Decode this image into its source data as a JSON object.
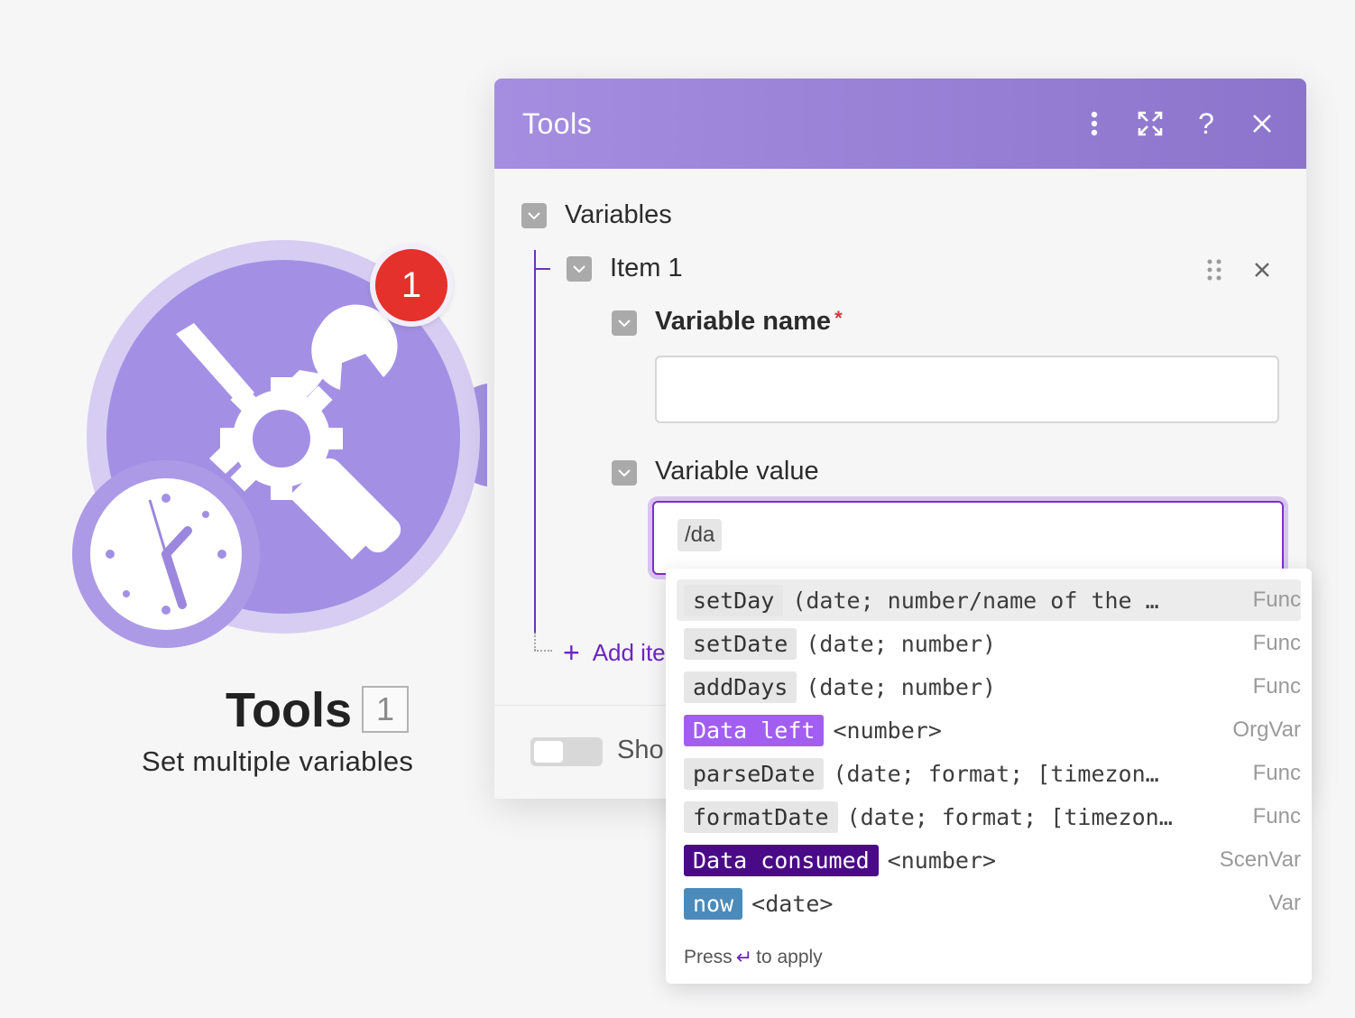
{
  "node": {
    "badge": "1",
    "title": "Tools",
    "count": "1",
    "subtitle": "Set multiple variables",
    "icon": "tools-wrench-screwdriver-gear-icon",
    "clock_icon": "clock-icon"
  },
  "panel": {
    "title": "Tools",
    "header_buttons": [
      "more-vertical-icon",
      "expand-icon",
      "help-icon",
      "close-icon"
    ],
    "help_label": "?",
    "variables_label": "Variables",
    "item_label": "Item 1",
    "variable_name_label": "Variable name",
    "required_mark": "*",
    "variable_name_value": "",
    "variable_value_label": "Variable value",
    "variable_value_token": "/da",
    "add_item_label": "Add ite",
    "add_item_plus": "+",
    "show_label": "Sho"
  },
  "dropdown": {
    "items": [
      {
        "name": "setDay",
        "args": "(date; number/name of the …",
        "kind": "Func",
        "chip": "func",
        "selected": true
      },
      {
        "name": "setDate",
        "args": "(date; number)",
        "kind": "Func",
        "chip": "func",
        "selected": false
      },
      {
        "name": "addDays",
        "args": "(date; number)",
        "kind": "Func",
        "chip": "func",
        "selected": false
      },
      {
        "name": "Data left",
        "args": "<number>",
        "kind": "OrgVar",
        "chip": "orgvar",
        "selected": false
      },
      {
        "name": "parseDate",
        "args": "(date; format; [timezon…",
        "kind": "Func",
        "chip": "func",
        "selected": false
      },
      {
        "name": "formatDate",
        "args": "(date; format; [timezon…",
        "kind": "Func",
        "chip": "func",
        "selected": false
      },
      {
        "name": "Data consumed",
        "args": "<number>",
        "kind": "ScenVar",
        "chip": "scenvar",
        "selected": false
      },
      {
        "name": "now",
        "args": "<date>",
        "kind": "Var",
        "chip": "var",
        "selected": false
      }
    ],
    "footer_press": "Press",
    "footer_enter": "↵",
    "footer_apply": "to apply"
  },
  "colors": {
    "header_start": "#a58ee0",
    "header_end": "#8c74cc",
    "accent": "#6b25c4",
    "badge": "#e4312b",
    "node_fill": "#a390e4",
    "chip_orgvar": "#a25ef0",
    "chip_scenvar": "#4a0a88",
    "chip_var": "#4b8bbb"
  }
}
